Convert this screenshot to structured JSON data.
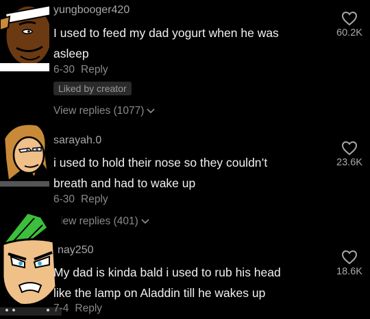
{
  "comments": [
    {
      "username": "yungbooger420",
      "text_lines": [
        "I used to feed my dad yogurt when he was",
        "asleep"
      ],
      "date": "6-30",
      "reply_label": "Reply",
      "badge": "Liked by creator",
      "view_replies": "View replies (1077)",
      "likes": "60.2K",
      "avatar_icon": "cartoon-avatar-headband-icon"
    },
    {
      "username": "sarayah.0",
      "text_lines": [
        "i used to hold their nose so they couldn’t",
        "breath and had to wake up"
      ],
      "date": "6-30",
      "reply_label": "Reply",
      "view_replies": "View replies (401)",
      "likes": "23.6K",
      "avatar_icon": "cartoon-avatar-blonde-icon"
    },
    {
      "username": "nay250",
      "text_lines": [
        "My dad is kinda bald i used to rub his head",
        "like the lamp on Aladdin till he wakes up"
      ],
      "date": "7-4",
      "reply_label": "Reply",
      "likes": "18.6K",
      "avatar_icon": "cartoon-avatar-mohawk-icon"
    }
  ],
  "colors": {
    "background": "#000000",
    "username": "#a8a8a8",
    "text": "#f1f1f1",
    "meta": "#8a8a8a",
    "badge_bg": "#2a2a2a"
  }
}
